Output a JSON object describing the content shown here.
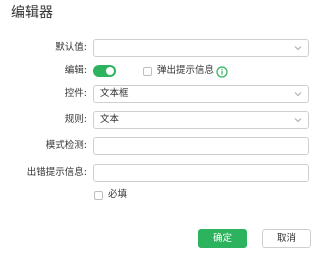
{
  "dialog": {
    "title": "编辑器"
  },
  "form": {
    "default_value": {
      "label": "默认值:",
      "value": ""
    },
    "edit": {
      "label": "编辑:",
      "toggle_on": true,
      "popup_hint_label": "弹出提示信息",
      "popup_hint_checked": false
    },
    "control": {
      "label": "控件:",
      "value": "文本框"
    },
    "rule": {
      "label": "规则:",
      "value": "文本"
    },
    "pattern": {
      "label": "模式检测:",
      "value": ""
    },
    "error_hint": {
      "label": "出错提示信息:",
      "value": ""
    },
    "required": {
      "label": "必填",
      "checked": false
    }
  },
  "footer": {
    "ok_label": "确定",
    "cancel_label": "取消"
  },
  "colors": {
    "accent": "#2db35d",
    "border": "#cfcfcf",
    "text": "#333333"
  }
}
